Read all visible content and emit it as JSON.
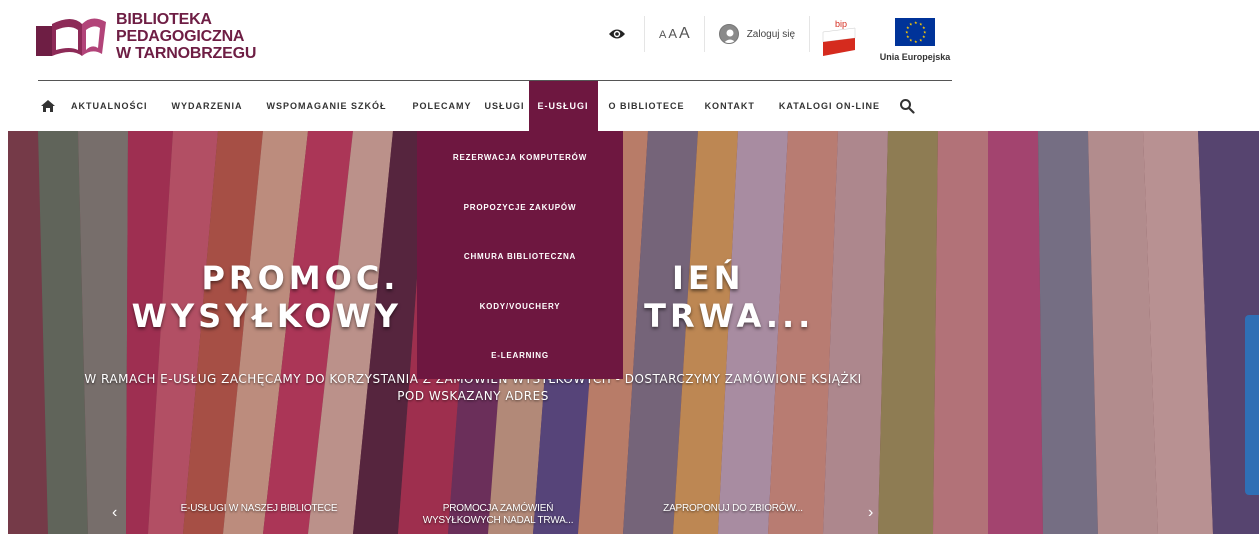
{
  "logo": {
    "line1": "BIBLIOTEKA",
    "line2": "PEDAGOGICZNA",
    "line3": "W TARNOBRZEGU"
  },
  "tools": {
    "font_small": "A",
    "font_medium": "A",
    "font_large": "A",
    "login_label": "Zaloguj się"
  },
  "bip": {
    "label": "bip"
  },
  "eu": {
    "label": "Unia Europejska"
  },
  "nav": {
    "items": [
      {
        "label": "AKTUALNOŚCI"
      },
      {
        "label": "WYDARZENIA"
      },
      {
        "label": "WSPOMAGANIE SZKÓŁ"
      },
      {
        "label": "POLECAMY"
      },
      {
        "label": "USŁUGI"
      },
      {
        "label": "E-USŁUGI"
      },
      {
        "label": "O BIBLIOTECE"
      },
      {
        "label": "KONTAKT"
      },
      {
        "label": "KATALOGI ON-LINE"
      }
    ]
  },
  "dropdown": {
    "items": [
      {
        "label": "REZERWACJA KOMPUTERÓW"
      },
      {
        "label": "PROPOZYCJE ZAKUPÓW"
      },
      {
        "label": "CHMURA BIBLIOTECZNA"
      },
      {
        "label": "KODY/VOUCHERY"
      },
      {
        "label": "E-LEARNING"
      }
    ]
  },
  "hero": {
    "title_line1": "PROMOC.                  IEŃ",
    "title_line2": "WYSYŁKOWY                TRWA...",
    "subtitle_line1": "W RAMACH E-USŁUG ZACHĘCAMY DO KORZYSTANIA Z ZAMÓWIEŃ WYSYŁKOWYCH - DOSTARCZYMY ZAMÓWIONE KSIĄŻKI",
    "subtitle_line2": "POD WSKAZANY ADRES",
    "slides": [
      {
        "label": "E-USŁUGI W NASZEJ BIBLIOTECE"
      },
      {
        "label_line1": "PROMOCJA ZAMÓWIEŃ",
        "label_line2": "WYSYŁKOWYCH NADAL TRWA..."
      },
      {
        "label": "ZAPROPONUJ DO ZBIORÓW..."
      }
    ],
    "prev": "‹",
    "next": "›"
  },
  "colors": {
    "brand": "#6e1740",
    "eu_blue": "#003399",
    "bip_red": "#d52b1e"
  }
}
